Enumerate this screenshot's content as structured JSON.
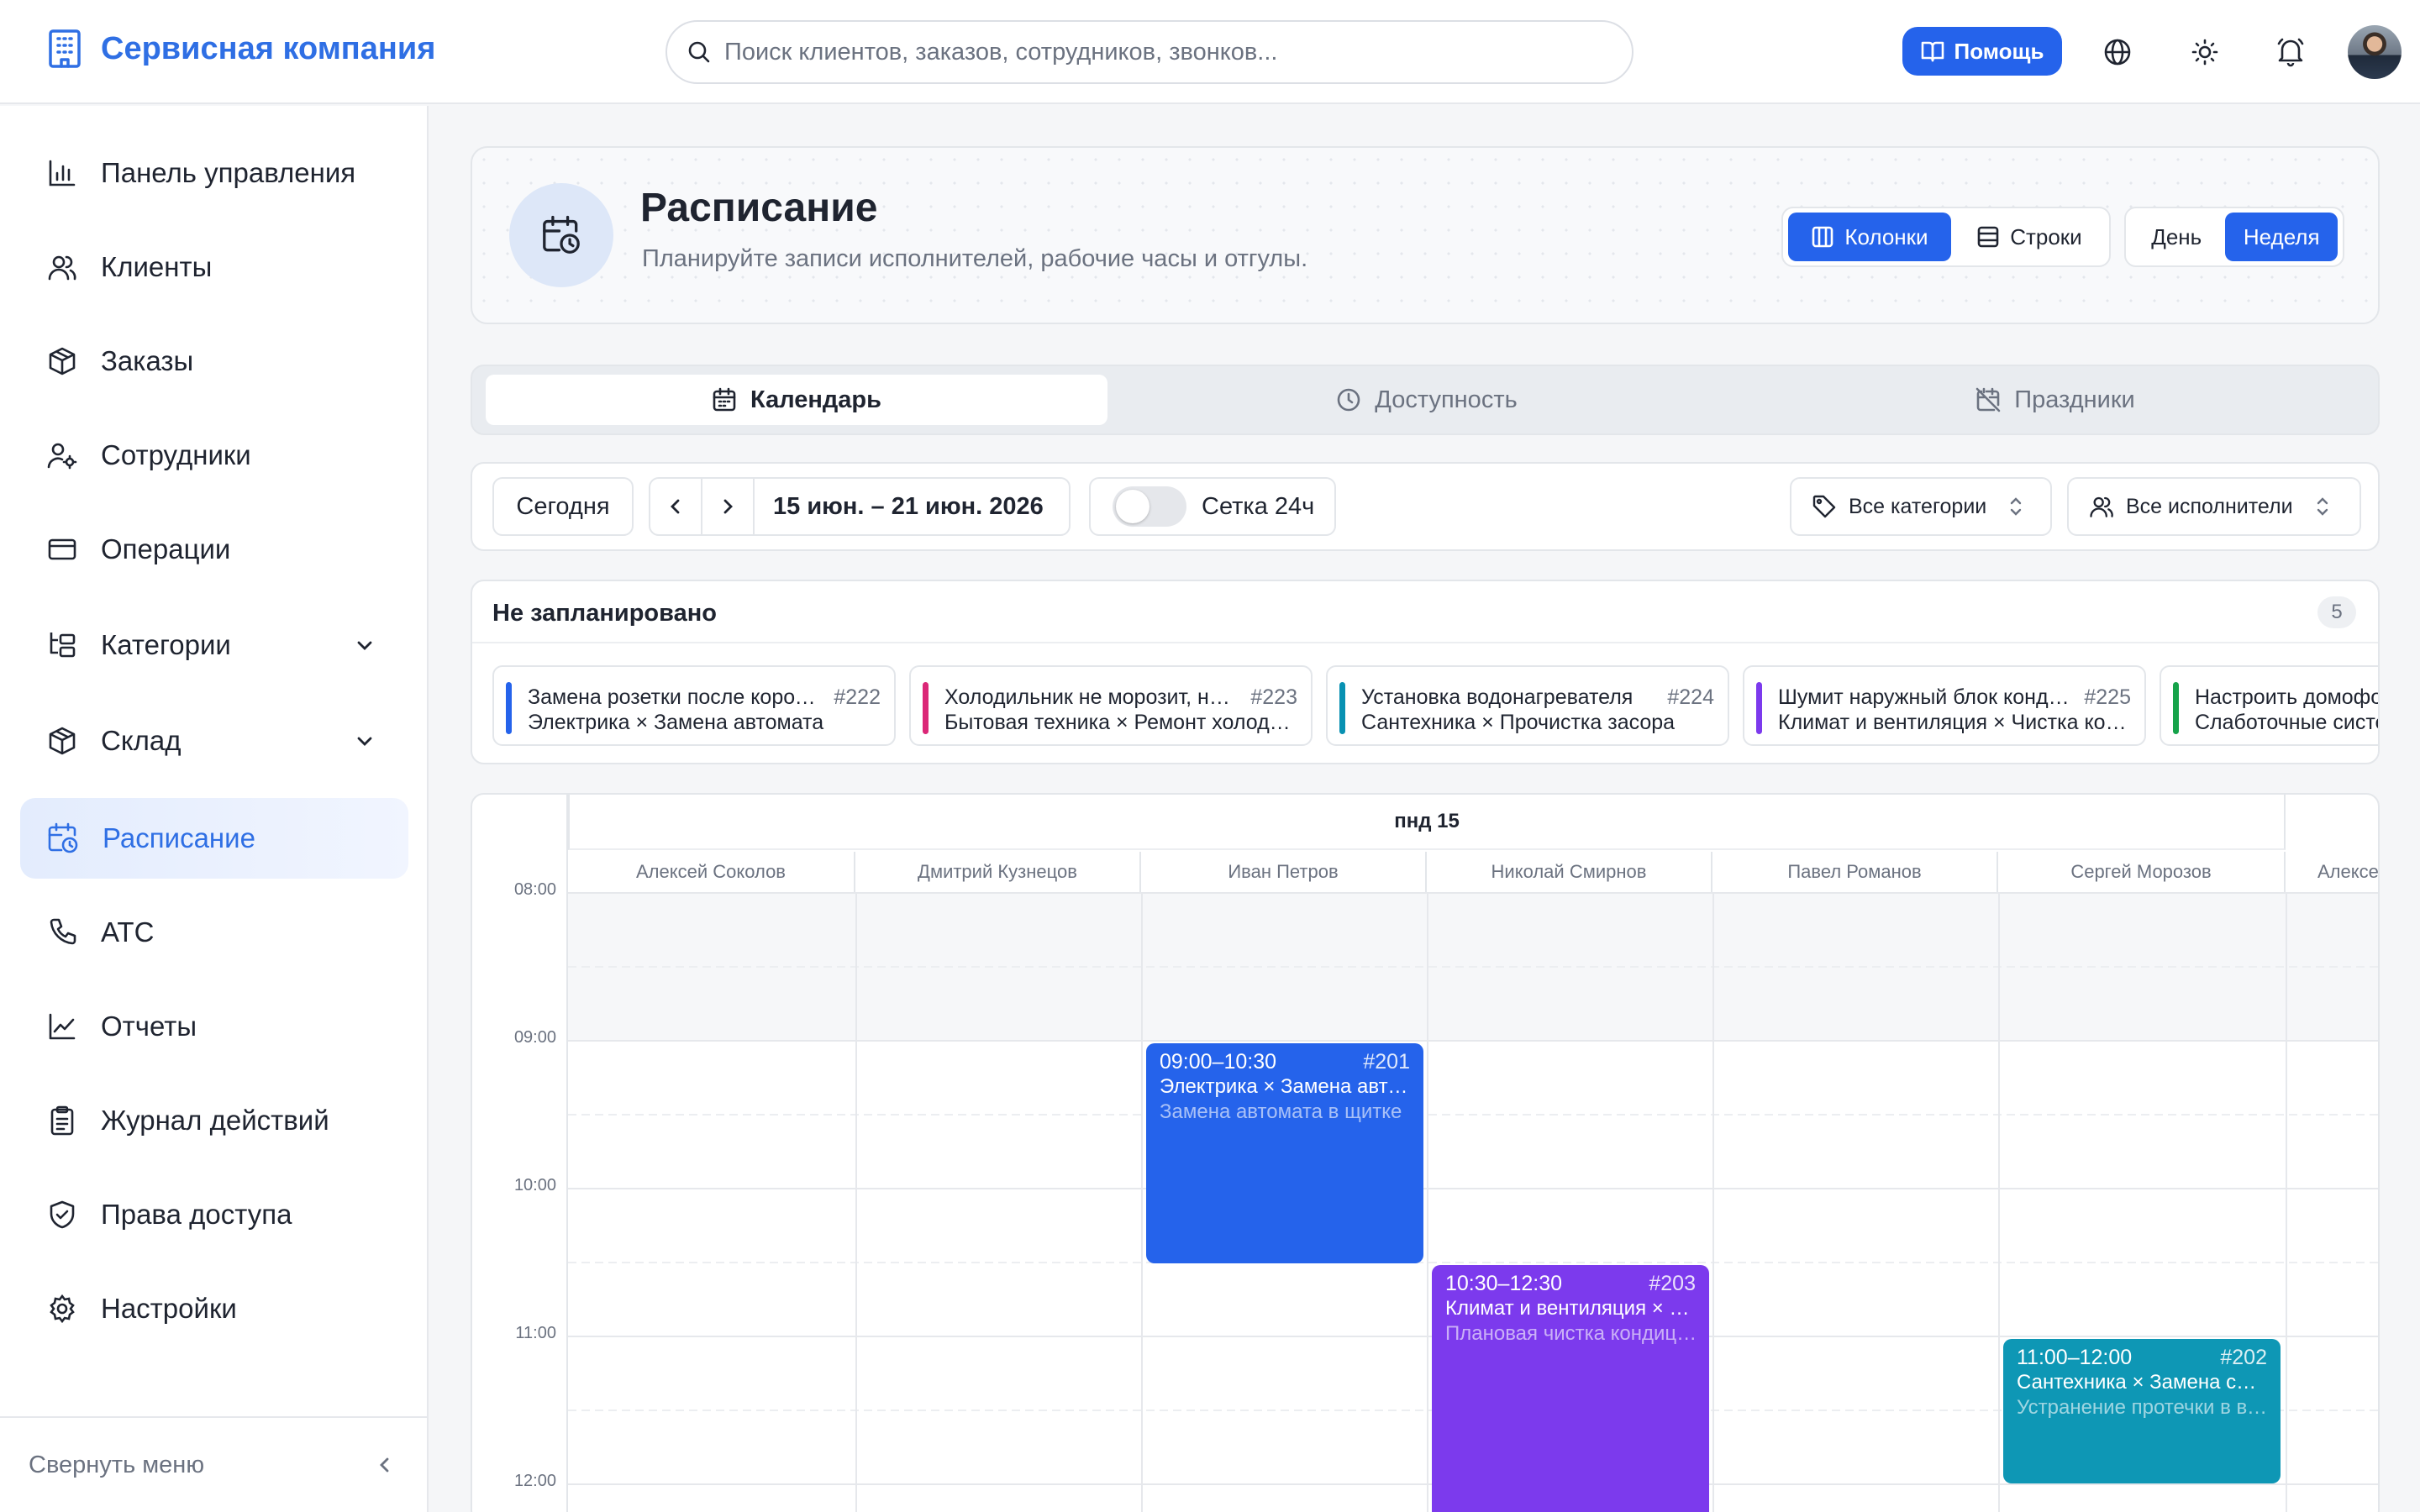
{
  "app": {
    "name": "Сервисная компания"
  },
  "search": {
    "placeholder": "Поиск клиентов, заказов, сотрудников, звонков..."
  },
  "header_actions": {
    "help_label": "Помощь"
  },
  "sidebar": {
    "items": [
      {
        "label": "Панель управления",
        "icon": "bar-chart-icon"
      },
      {
        "label": "Клиенты",
        "icon": "users-icon"
      },
      {
        "label": "Заказы",
        "icon": "package-icon"
      },
      {
        "label": "Сотрудники",
        "icon": "user-cog-icon"
      },
      {
        "label": "Операции",
        "icon": "credit-card-icon"
      },
      {
        "label": "Категории",
        "icon": "folder-tree-icon",
        "expandable": true
      },
      {
        "label": "Склад",
        "icon": "package-icon",
        "expandable": true
      },
      {
        "label": "Расписание",
        "icon": "calendar-clock-icon",
        "active": true
      },
      {
        "label": "АТС",
        "icon": "phone-icon"
      },
      {
        "label": "Отчеты",
        "icon": "line-chart-icon"
      },
      {
        "label": "Журнал действий",
        "icon": "clipboard-icon"
      },
      {
        "label": "Права доступа",
        "icon": "shield-check-icon"
      },
      {
        "label": "Настройки",
        "icon": "gear-icon"
      }
    ],
    "collapse_label": "Свернуть меню"
  },
  "page": {
    "title": "Расписание",
    "subtitle": "Планируйте записи исполнителей, рабочие часы и отгулы.",
    "layout_toggle": {
      "columns": "Колонки",
      "rows": "Строки",
      "selected": "Колонки"
    },
    "period_toggle": {
      "day": "День",
      "week": "Неделя",
      "selected": "Неделя"
    }
  },
  "tabs": [
    {
      "label": "Календарь",
      "icon": "calendar-icon",
      "active": true
    },
    {
      "label": "Доступность",
      "icon": "clock-icon"
    },
    {
      "label": "Праздники",
      "icon": "calendar-off-icon"
    }
  ],
  "toolbar": {
    "today": "Сегодня",
    "range": "15 июн. – 21 июн. 2026",
    "grid24_label": "Сетка 24ч",
    "grid24_on": false,
    "category_filter": "Все категории",
    "assignee_filter": "Все исполнители"
  },
  "unplanned": {
    "title": "Не запланировано",
    "count": "5",
    "items": [
      {
        "title": "Замена розетки после короткого замыкания",
        "number": "#222",
        "subtitle": "Электрика × Замена автомата",
        "color": "#2563eb"
      },
      {
        "title": "Холодильник не морозит, нужна диагностика",
        "number": "#223",
        "subtitle": "Бытовая техника × Ремонт холодильника",
        "color": "#db2777"
      },
      {
        "title": "Установка водонагревателя",
        "number": "#224",
        "subtitle": "Сантехника × Прочистка засора",
        "color": "#0891b2"
      },
      {
        "title": "Шумит наружный блок кондиционера",
        "number": "#225",
        "subtitle": "Климат и вентиляция × Чистка кондиционера",
        "color": "#7c3aed"
      },
      {
        "title": "Настроить домофон",
        "number": "",
        "subtitle": "Слаботочные системы",
        "color": "#16a34a"
      }
    ]
  },
  "calendar": {
    "day_label": "пнд 15",
    "time_labels": [
      "08:00",
      "09:00",
      "10:00",
      "11:00",
      "12:00"
    ],
    "columns": [
      "Алексей Соколов",
      "Дмитрий Кузнецов",
      "Иван Петров",
      "Николай Смирнов",
      "Павел Романов",
      "Сергей Морозов",
      "Алексей"
    ],
    "events": [
      {
        "time": "09:00–10:30",
        "number": "#201",
        "title": "Электрика × Замена автомата",
        "description": "Замена автомата в щитке",
        "color": "#2563eb",
        "column": "Иван Петров",
        "start": "09:00",
        "end": "10:30"
      },
      {
        "time": "10:30–12:30",
        "number": "#203",
        "title": "Климат и вентиляция × Чистка кондиционера",
        "description": "Плановая чистка кондиционера",
        "color": "#7c3aed",
        "column": "Николай Смирнов",
        "start": "10:30",
        "end": "12:30"
      },
      {
        "time": "11:00–12:00",
        "number": "#202",
        "title": "Сантехника × Замена смесителя",
        "description": "Устранение протечки в ванной",
        "color": "#0e97b5",
        "column": "Сергей Морозов",
        "start": "11:00",
        "end": "12:00"
      }
    ]
  }
}
